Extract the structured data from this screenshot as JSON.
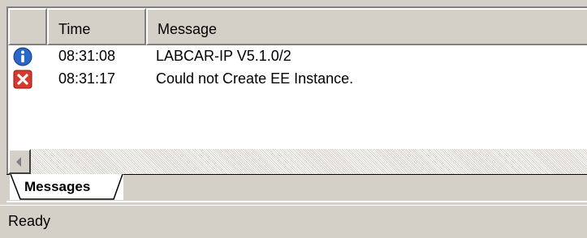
{
  "table": {
    "columns": [
      "",
      "Time",
      "Message"
    ],
    "rows": [
      {
        "icon": "info-icon",
        "time": "08:31:08",
        "message": "LABCAR-IP V5.1.0/2"
      },
      {
        "icon": "error-icon",
        "time": "08:31:17",
        "message": "Could not Create EE Instance."
      }
    ]
  },
  "tabs": [
    {
      "label": "Messages"
    }
  ],
  "status": {
    "text": "Ready"
  },
  "colors": {
    "info": "#2a68c8",
    "error": "#d63a2f",
    "chrome": "#d4d0c8"
  }
}
